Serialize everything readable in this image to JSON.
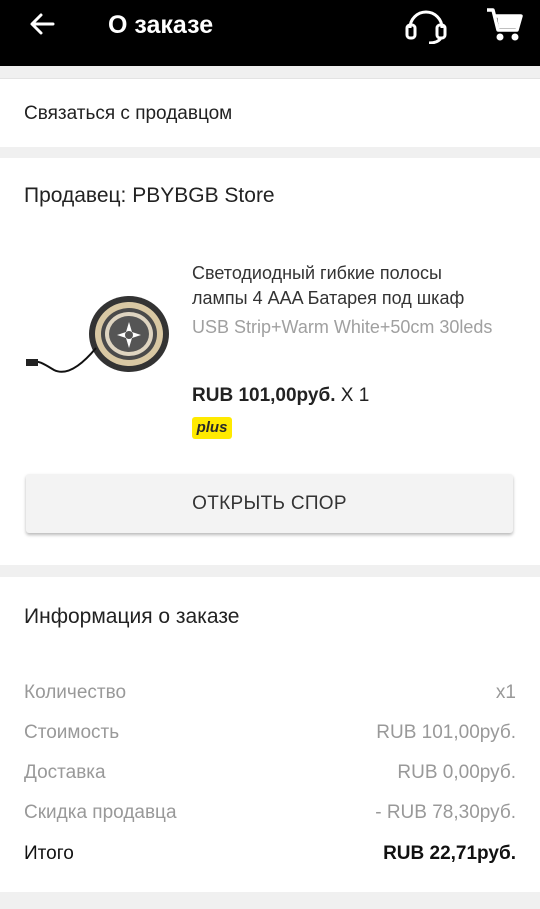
{
  "header": {
    "title": "О заказе",
    "back_icon": "arrow-left-icon",
    "support_icon": "headset-icon",
    "cart_icon": "cart-icon"
  },
  "contact": {
    "label": "Связаться с продавцом"
  },
  "seller": {
    "name": "Продавец: PBYBGB Store",
    "product": {
      "title_line1": "Светодиодный гибкие полосы",
      "title_line2": "лампы 4 AAA Батарея под шкаф",
      "variant": "USB Strip+Warm White+50cm 30leds",
      "price": "RUB 101,00руб.",
      "quantity": "X 1",
      "badge": "plus",
      "image_icon": "led-strip-reel-icon"
    },
    "dispute_button": "ОТКРЫТЬ СПОР"
  },
  "order_info": {
    "title": "Информация о заказе",
    "rows": [
      {
        "label": "Количество",
        "value": "x1"
      },
      {
        "label": "Стоимость",
        "value": "RUB 101,00руб."
      },
      {
        "label": "Доставка",
        "value": "RUB 0,00руб."
      },
      {
        "label": "Скидка продавца",
        "value": "- RUB 78,30руб."
      },
      {
        "label": "Итого",
        "value": "RUB 22,71руб."
      }
    ]
  },
  "colors": {
    "header_bg": "#000000",
    "badge_bg": "#ffea00",
    "muted_text": "#999999"
  }
}
